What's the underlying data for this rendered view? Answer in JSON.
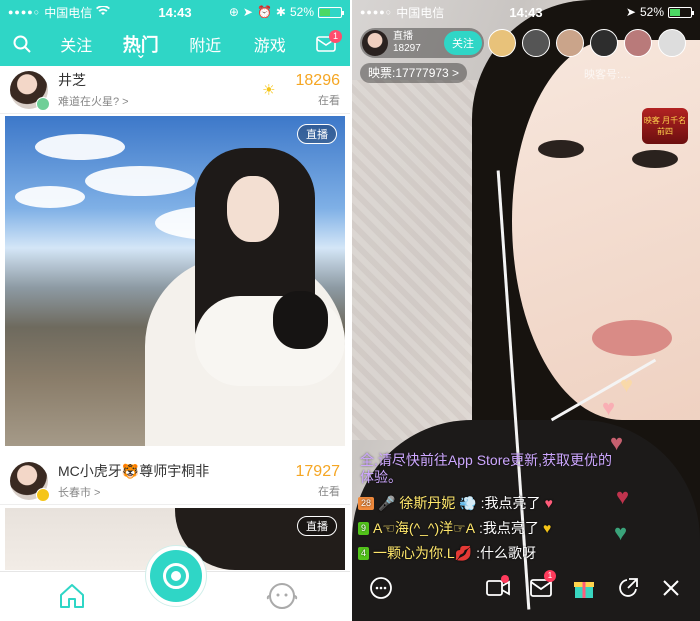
{
  "left": {
    "status": {
      "signal": "●●●●○",
      "carrier": "中国电信",
      "time": "14:43",
      "battery": "52%"
    },
    "nav": {
      "tabs": [
        "关注",
        "热门",
        "附近",
        "游戏"
      ],
      "active_tab": "热门",
      "mail_badge": "1"
    },
    "feed": [
      {
        "name": "井芝",
        "subtitle": "难道在火星? >",
        "count": "18296",
        "watching": "在看",
        "live": "直播"
      },
      {
        "name": "MC小虎牙🐯尊师宇桐非",
        "subtitle": "长春市 >",
        "count": "17927",
        "watching": "在看",
        "live": "直播"
      }
    ]
  },
  "right": {
    "status": {
      "signal": "●●●●○",
      "carrier": "中国电信",
      "time": "14:43",
      "battery": "52%"
    },
    "anchor": {
      "label": "直播",
      "viewers": "18297",
      "follow": "关注"
    },
    "ticket": "映票:17777973 >",
    "watermark": "映客号:…",
    "rank_badge": "映客 月千名前四",
    "system_message": "全,请尽快前往App Store更新,获取更优的体验。",
    "chats": [
      {
        "level": "28",
        "user": "🎤 徐斯丹妮 💨",
        "text": ":我点亮了",
        "heart": "♥"
      },
      {
        "level": "9",
        "user": "A☜海(^_^)洋☞A",
        "text": ":我点亮了",
        "heart": "♥"
      },
      {
        "level": "4",
        "user": "一颗心为你.L💋",
        "text": ":什么歌呀",
        "heart": ""
      }
    ],
    "msg_badge": "1",
    "colors": {
      "accent": "#2fd6c6",
      "system_text": "#cda7ff",
      "highlight": "#ffe76b"
    }
  }
}
